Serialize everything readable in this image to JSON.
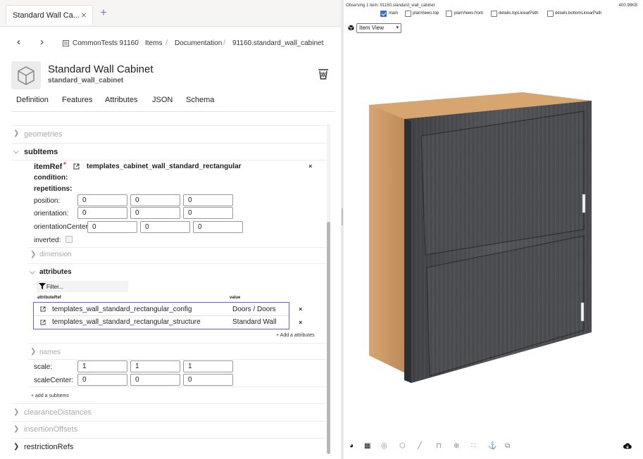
{
  "tab": {
    "title": "Standard Wall Ca...",
    "close": "×",
    "new": "+"
  },
  "breadcrumb": {
    "back": "‹",
    "forward": "›",
    "root": "CommonTests 91160",
    "items": "Items",
    "docs": "Documentation",
    "current": "91160.standard_wall_cabinet",
    "sep": "/"
  },
  "header": {
    "title": "Standard Wall Cabinet",
    "subtitle": "standard_wall_cabinet"
  },
  "tabs": [
    "Definition",
    "Features",
    "Attributes",
    "JSON",
    "Schema"
  ],
  "sections": {
    "geometries": "geometries",
    "subitems": "subItems",
    "dimension": "dimension",
    "attributes": "attributes",
    "names": "names",
    "clearance": "clearanceDistances",
    "insertion": "insertionOffsets",
    "restriction": "restrictionRefs"
  },
  "subitem": {
    "itemref_label": "itemRef",
    "required": "*",
    "itemref_value": "templates_cabinet_wall_standard_rectangular",
    "condition": "condition:",
    "repetitions": "repetitions:",
    "position_label": "position:",
    "position": [
      "0",
      "0",
      "0"
    ],
    "orientation_label": "orientation:",
    "orientation": [
      "0",
      "0",
      "0"
    ],
    "orientation_center_label": "orientationCenter:",
    "orientation_center": [
      "0",
      "0",
      "0"
    ],
    "inverted_label": "inverted:",
    "scale_label": "scale:",
    "scale": [
      "1",
      "1",
      "1"
    ],
    "scale_center_label": "scaleCenter:",
    "scale_center": [
      "0",
      "0",
      "0"
    ],
    "remove": "×"
  },
  "attributes_table": {
    "filter_placeholder": "Filter...",
    "col_ref": "attributeRef",
    "col_value": "value",
    "rows": [
      {
        "ref": "templates_wall_standard_rectangular_config",
        "value": "Doors / Doors"
      },
      {
        "ref": "templates_wall_standard_rectangular_structure",
        "value": "Standard Wall"
      }
    ],
    "add_label": "+ Add a attributes"
  },
  "add_subitems": "+ add a subItems",
  "viewer": {
    "observing": "Observing 1 item: 91160.standard_wall_cabinet",
    "size": "400.98KB",
    "checkboxes": [
      {
        "label": "main",
        "checked": true
      },
      {
        "label": "planViews.top",
        "checked": false
      },
      {
        "label": "planViews.front",
        "checked": false
      },
      {
        "label": "details.topLinearPath",
        "checked": false
      },
      {
        "label": "details.bottomLinearPath",
        "checked": false
      }
    ],
    "view_mode": "Item View"
  },
  "colors": {
    "accent": "#7a56d0",
    "checkbox": "#3b6fd1",
    "cabinet_face": "#4a4b4f",
    "cabinet_side": "#c79562"
  }
}
